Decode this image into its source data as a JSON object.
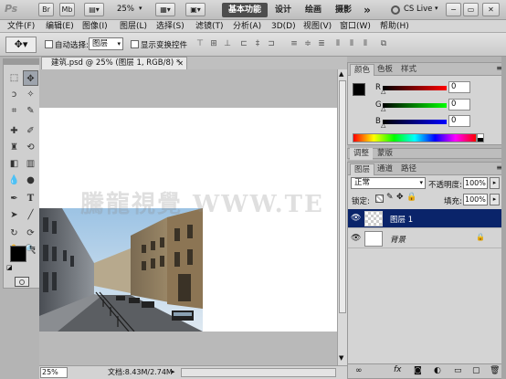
{
  "titlebar": {
    "ps_logo": "Ps",
    "br_label": "Br",
    "mb_label": "Mb",
    "zoom": "25%",
    "workspace_active": "基本功能",
    "workspace_design": "设计",
    "workspace_paint": "绘画",
    "workspace_photo": "摄影",
    "more": "»",
    "cslive": "CS Live"
  },
  "menu": [
    "文件(F)",
    "编辑(E)",
    "图像(I)",
    "图层(L)",
    "选择(S)",
    "滤镜(T)",
    "分析(A)",
    "3D(D)",
    "视图(V)",
    "窗口(W)",
    "帮助(H)"
  ],
  "options": {
    "auto_select_label": "自动选择:",
    "auto_select_value": "图层",
    "show_transform_label": "显示变换控件"
  },
  "document": {
    "tab_title": "建筑.psd @ 25% (图层 1, RGB/8) *",
    "zoom": "25%",
    "doc_size": "文档:8.43M/2.74M"
  },
  "watermark": "騰龍視覺 WWW.TE",
  "color_panel": {
    "tabs": [
      "颜色",
      "色板",
      "样式"
    ],
    "r_label": "R",
    "g_label": "G",
    "b_label": "B",
    "r_value": "0",
    "g_value": "0",
    "b_value": "0"
  },
  "adjust_panel": {
    "tabs": [
      "调整",
      "蒙版"
    ]
  },
  "layers_panel": {
    "tabs": [
      "图层",
      "通道",
      "路径"
    ],
    "blend_mode": "正常",
    "opacity_label": "不透明度:",
    "opacity_value": "100%",
    "lock_label": "锁定:",
    "fill_label": "填充:",
    "fill_value": "100%",
    "layers": [
      {
        "name": "图层 1",
        "selected": true
      },
      {
        "name": "背景",
        "selected": false,
        "italic": true
      }
    ]
  },
  "colors": {
    "accent_selected": "#0a246a",
    "foreground": "#000000",
    "background": "#ffffff"
  }
}
